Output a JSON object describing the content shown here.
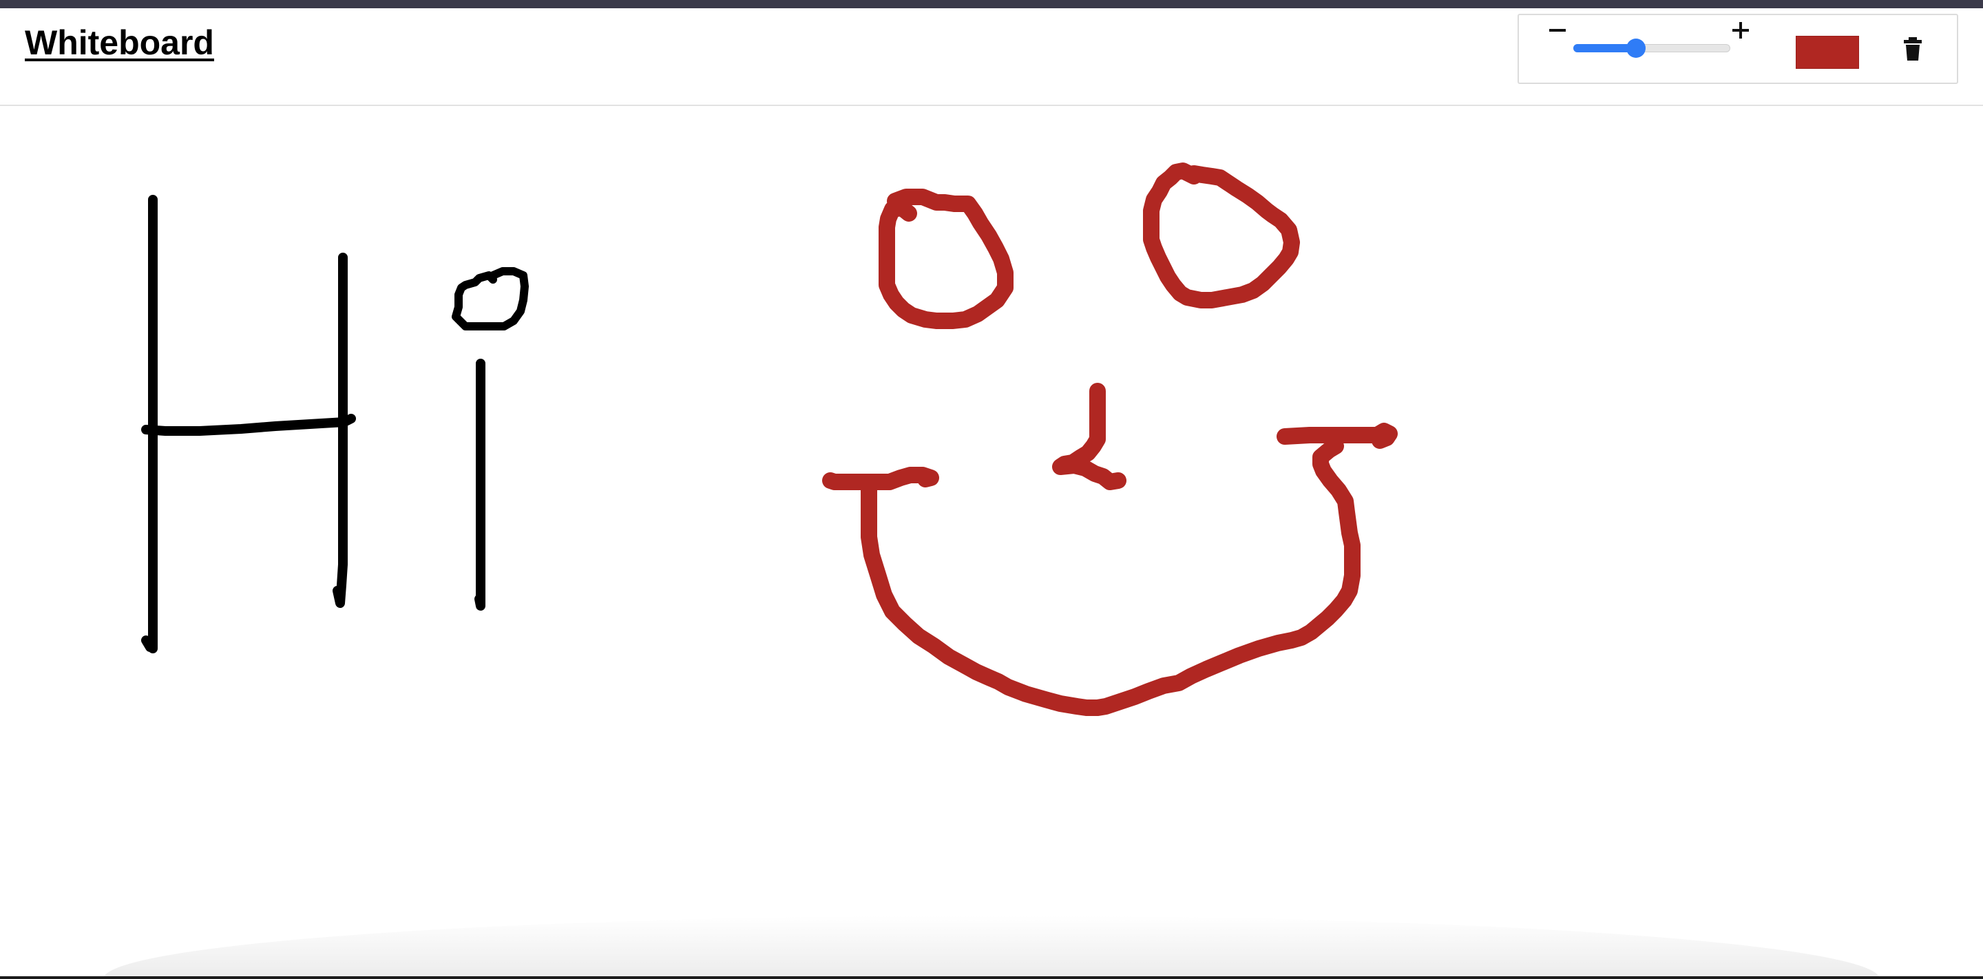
{
  "app": {
    "title": "Whiteboard"
  },
  "toolbar": {
    "decrease_icon": "minus-icon",
    "increase_icon": "plus-icon",
    "decrease_symbol": "−",
    "increase_symbol": "+",
    "brush_size_fraction": 0.4,
    "current_color": "#b02722",
    "clear_icon": "trash-icon"
  },
  "strokes": [
    {
      "name": "stroke-h-left",
      "color": "#000000",
      "width": "thin"
    },
    {
      "name": "stroke-h-crossbar",
      "color": "#000000",
      "width": "thin"
    },
    {
      "name": "stroke-h-right",
      "color": "#000000",
      "width": "thin"
    },
    {
      "name": "stroke-i-dot",
      "color": "#000000",
      "width": "thin"
    },
    {
      "name": "stroke-i-stem",
      "color": "#000000",
      "width": "thin"
    },
    {
      "name": "stroke-left-eye",
      "color": "#b02722",
      "width": "thick"
    },
    {
      "name": "stroke-right-eye",
      "color": "#b02722",
      "width": "thick"
    },
    {
      "name": "stroke-nose",
      "color": "#b02722",
      "width": "thick"
    },
    {
      "name": "stroke-mouth",
      "color": "#b02722",
      "width": "thick"
    }
  ],
  "colors": {
    "ink_black": "#000000",
    "ink_red": "#b02722",
    "accent_blue": "#2f7cf6",
    "top_strip": "#3b3a4a"
  }
}
